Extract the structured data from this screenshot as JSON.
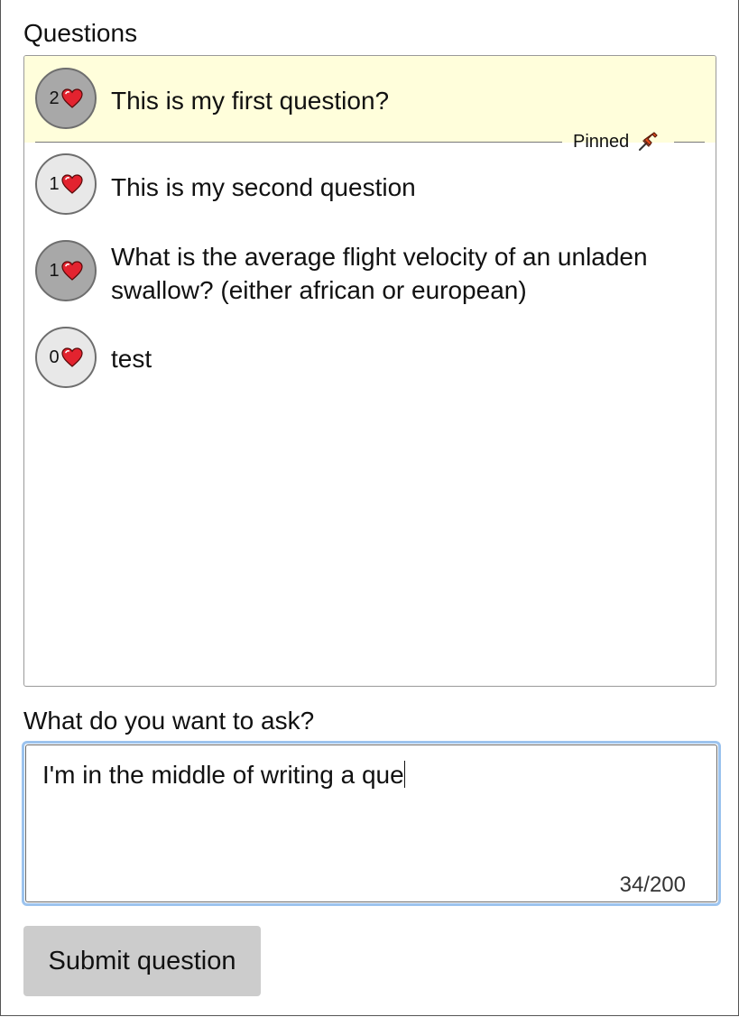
{
  "questions_title": "Questions",
  "questions": [
    {
      "votes": "2",
      "text": "This is my first question?",
      "pinned": true,
      "voted": true
    },
    {
      "votes": "1",
      "text": "This is my second question",
      "pinned": false,
      "voted": false
    },
    {
      "votes": "1",
      "text": "What is the average flight velocity of an unladen swallow? (either african or european)",
      "pinned": false,
      "voted": true
    },
    {
      "votes": "0",
      "text": "test",
      "pinned": false,
      "voted": false
    }
  ],
  "pinned_label": "Pinned",
  "ask": {
    "label": "What do you want to ask?",
    "value": "I'm in the middle of writing a que",
    "char_count": "34/200"
  },
  "submit_label": "Submit question",
  "colors": {
    "pinned_background": "#fffedb",
    "focus_ring": "#9cc3ee",
    "heart": "#e3232f",
    "voted_circle": "#a8a8a8",
    "unvoted_circle": "#e8e8e8",
    "button": "#cccccc"
  }
}
